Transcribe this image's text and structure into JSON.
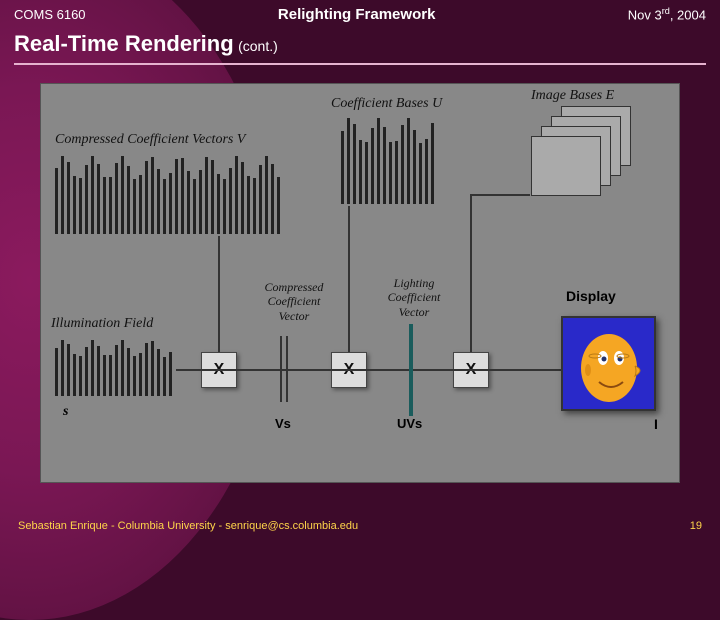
{
  "header": {
    "left": "COMS 6160",
    "center": "Relighting Framework",
    "right_pre": "Nov 3",
    "right_sup": "rd",
    "right_post": ", 2004"
  },
  "title": {
    "main": "Real-Time Rendering",
    "sub": " (cont.)"
  },
  "diagram": {
    "compressed_coeff_vectors": "Compressed Coefficient Vectors  V",
    "coeff_bases": "Coefficient Bases U",
    "image_bases": "Image Bases  E",
    "illumination_field": "Illumination Field",
    "s_label": "s",
    "compressed_coeff_vector": "Compressed\nCoefficient\nVector",
    "lighting_coeff_vector": "Lighting\nCoefficient\nVector",
    "vs_label": "Vs",
    "uvs_label": "UVs",
    "display_label": "Display",
    "i_label": "I",
    "x": "X"
  },
  "footer": {
    "text": "Sebastian Enrique - Columbia University - senrique@cs.columbia.edu",
    "page": "19"
  }
}
